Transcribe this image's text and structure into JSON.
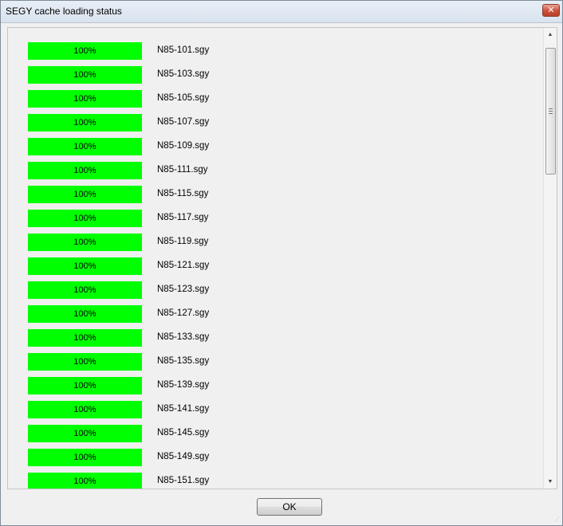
{
  "window": {
    "title": "SEGY cache loading status",
    "close_glyph": "✕"
  },
  "items": [
    {
      "progress_label": "100%",
      "progress_fraction": 1.0,
      "filename": "N85-101.sgy"
    },
    {
      "progress_label": "100%",
      "progress_fraction": 1.0,
      "filename": "N85-103.sgy"
    },
    {
      "progress_label": "100%",
      "progress_fraction": 1.0,
      "filename": "N85-105.sgy"
    },
    {
      "progress_label": "100%",
      "progress_fraction": 1.0,
      "filename": "N85-107.sgy"
    },
    {
      "progress_label": "100%",
      "progress_fraction": 1.0,
      "filename": "N85-109.sgy"
    },
    {
      "progress_label": "100%",
      "progress_fraction": 1.0,
      "filename": "N85-111.sgy"
    },
    {
      "progress_label": "100%",
      "progress_fraction": 1.0,
      "filename": "N85-115.sgy"
    },
    {
      "progress_label": "100%",
      "progress_fraction": 1.0,
      "filename": "N85-117.sgy"
    },
    {
      "progress_label": "100%",
      "progress_fraction": 1.0,
      "filename": "N85-119.sgy"
    },
    {
      "progress_label": "100%",
      "progress_fraction": 1.0,
      "filename": "N85-121.sgy"
    },
    {
      "progress_label": "100%",
      "progress_fraction": 1.0,
      "filename": "N85-123.sgy"
    },
    {
      "progress_label": "100%",
      "progress_fraction": 1.0,
      "filename": "N85-127.sgy"
    },
    {
      "progress_label": "100%",
      "progress_fraction": 1.0,
      "filename": "N85-133.sgy"
    },
    {
      "progress_label": "100%",
      "progress_fraction": 1.0,
      "filename": "N85-135.sgy"
    },
    {
      "progress_label": "100%",
      "progress_fraction": 1.0,
      "filename": "N85-139.sgy"
    },
    {
      "progress_label": "100%",
      "progress_fraction": 1.0,
      "filename": "N85-141.sgy"
    },
    {
      "progress_label": "100%",
      "progress_fraction": 1.0,
      "filename": "N85-145.sgy"
    },
    {
      "progress_label": "100%",
      "progress_fraction": 1.0,
      "filename": "N85-149.sgy"
    },
    {
      "progress_label": "100%",
      "progress_fraction": 1.0,
      "filename": "N85-151.sgy"
    }
  ],
  "scrollbar": {
    "up_arrow_icon": "chevron-up-icon",
    "down_arrow_icon": "chevron-down-icon"
  },
  "buttons": {
    "ok_label": "OK"
  },
  "colors": {
    "progress_fill": "#00ff00",
    "window_background": "#f0f0f0"
  }
}
